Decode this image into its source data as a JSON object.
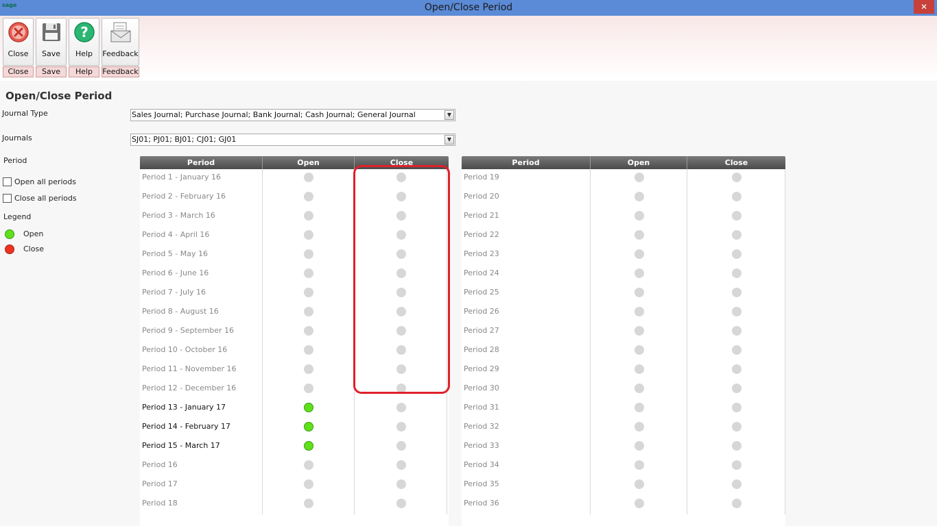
{
  "window": {
    "app_logo": "sage",
    "title": "Open/Close Period",
    "close_glyph": "✕"
  },
  "toolbar": {
    "buttons": [
      {
        "label": "Close",
        "caption": "Close",
        "icon": "close-circle-icon"
      },
      {
        "label": "Save",
        "caption": "Save",
        "icon": "floppy-disk-icon"
      },
      {
        "label": "Help",
        "caption": "Help",
        "icon": "help-question-icon"
      },
      {
        "label": "Feedback",
        "caption": "Feedback",
        "icon": "feedback-letter-icon"
      }
    ]
  },
  "page": {
    "title": "Open/Close Period",
    "journal_type_label": "Journal Type",
    "journal_type_value": "Sales Journal; Purchase Journal; Bank Journal; Cash Journal; General Journal",
    "journals_label": "Journals",
    "journals_value": "SJ01; PJ01; BJ01; CJ01; GJ01",
    "period_label": "Period",
    "open_all_label": "Open all periods",
    "close_all_label": "Close all periods",
    "legend_label": "Legend",
    "legend_open": "Open",
    "legend_close": "Close",
    "colors": {
      "open": "#5fe01a",
      "close": "#ee3322",
      "inactive": "#d7d7d7"
    }
  },
  "grid": {
    "headers": {
      "period": "Period",
      "open": "Open",
      "close": "Close"
    },
    "left": [
      {
        "name": "Period 1 - January 16",
        "active": false,
        "open": false,
        "close": false
      },
      {
        "name": "Period 2 - February 16",
        "active": false,
        "open": false,
        "close": false
      },
      {
        "name": "Period 3 - March 16",
        "active": false,
        "open": false,
        "close": false
      },
      {
        "name": "Period 4 - April 16",
        "active": false,
        "open": false,
        "close": false
      },
      {
        "name": "Period 5 - May 16",
        "active": false,
        "open": false,
        "close": false
      },
      {
        "name": "Period 6 - June 16",
        "active": false,
        "open": false,
        "close": false
      },
      {
        "name": "Period 7 - July 16",
        "active": false,
        "open": false,
        "close": false
      },
      {
        "name": "Period 8 - August 16",
        "active": false,
        "open": false,
        "close": false
      },
      {
        "name": "Period 9 - September 16",
        "active": false,
        "open": false,
        "close": false
      },
      {
        "name": "Period 10 - October 16",
        "active": false,
        "open": false,
        "close": false
      },
      {
        "name": "Period 11 - November 16",
        "active": false,
        "open": false,
        "close": false
      },
      {
        "name": "Period 12 - December 16",
        "active": false,
        "open": false,
        "close": false
      },
      {
        "name": "Period 13 - January 17",
        "active": true,
        "open": true,
        "close": false
      },
      {
        "name": "Period 14 - February 17",
        "active": true,
        "open": true,
        "close": false
      },
      {
        "name": "Period 15 - March 17",
        "active": true,
        "open": true,
        "close": false
      },
      {
        "name": "Period 16",
        "active": false,
        "open": false,
        "close": false
      },
      {
        "name": "Period 17",
        "active": false,
        "open": false,
        "close": false
      },
      {
        "name": "Period 18",
        "active": false,
        "open": false,
        "close": false
      }
    ],
    "right": [
      {
        "name": "Period 19",
        "active": false,
        "open": false,
        "close": false
      },
      {
        "name": "Period 20",
        "active": false,
        "open": false,
        "close": false
      },
      {
        "name": "Period 21",
        "active": false,
        "open": false,
        "close": false
      },
      {
        "name": "Period 22",
        "active": false,
        "open": false,
        "close": false
      },
      {
        "name": "Period 23",
        "active": false,
        "open": false,
        "close": false
      },
      {
        "name": "Period 24",
        "active": false,
        "open": false,
        "close": false
      },
      {
        "name": "Period 25",
        "active": false,
        "open": false,
        "close": false
      },
      {
        "name": "Period 26",
        "active": false,
        "open": false,
        "close": false
      },
      {
        "name": "Period 27",
        "active": false,
        "open": false,
        "close": false
      },
      {
        "name": "Period 28",
        "active": false,
        "open": false,
        "close": false
      },
      {
        "name": "Period 29",
        "active": false,
        "open": false,
        "close": false
      },
      {
        "name": "Period 30",
        "active": false,
        "open": false,
        "close": false
      },
      {
        "name": "Period 31",
        "active": false,
        "open": false,
        "close": false
      },
      {
        "name": "Period 32",
        "active": false,
        "open": false,
        "close": false
      },
      {
        "name": "Period 33",
        "active": false,
        "open": false,
        "close": false
      },
      {
        "name": "Period 34",
        "active": false,
        "open": false,
        "close": false
      },
      {
        "name": "Period 35",
        "active": false,
        "open": false,
        "close": false
      },
      {
        "name": "Period 36",
        "active": false,
        "open": false,
        "close": false
      }
    ]
  }
}
